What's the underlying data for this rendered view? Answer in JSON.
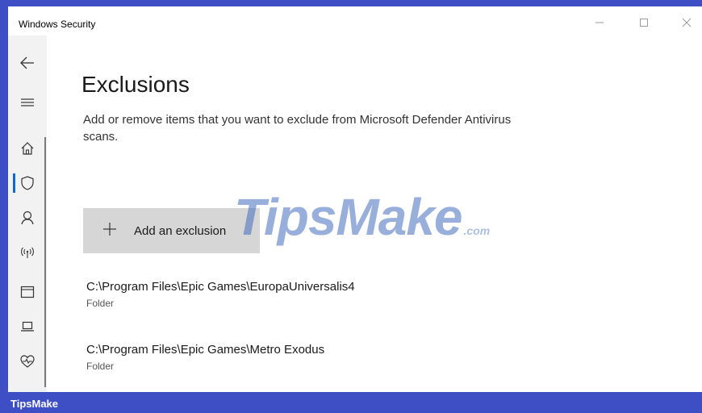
{
  "window": {
    "title": "Windows Security"
  },
  "sidebar": {
    "items": [
      {
        "icon": "back-arrow-icon"
      },
      {
        "icon": "hamburger-menu-icon"
      },
      {
        "icon": "home-icon"
      },
      {
        "icon": "shield-icon",
        "selected": true
      },
      {
        "icon": "account-icon"
      },
      {
        "icon": "network-icon"
      },
      {
        "icon": "app-browser-icon"
      },
      {
        "icon": "device-security-icon"
      },
      {
        "icon": "device-health-icon"
      }
    ],
    "accent_color": "#0b6bd0"
  },
  "main": {
    "title": "Exclusions",
    "description": "Add or remove items that you want to exclude from Microsoft Defender Antivirus scans.",
    "add_button": {
      "icon": "plus-icon",
      "label": "Add an exclusion"
    },
    "exclusions": [
      {
        "path": "C:\\Program Files\\Epic Games\\EuropaUniversalis4",
        "type": "Folder"
      },
      {
        "path": "C:\\Program Files\\Epic Games\\Metro Exodus",
        "type": "Folder"
      }
    ]
  },
  "watermark": {
    "main": "TipsMake",
    "sub": ".com"
  },
  "footer": {
    "text": "TipsMake",
    "color": "#3e4ec4"
  }
}
